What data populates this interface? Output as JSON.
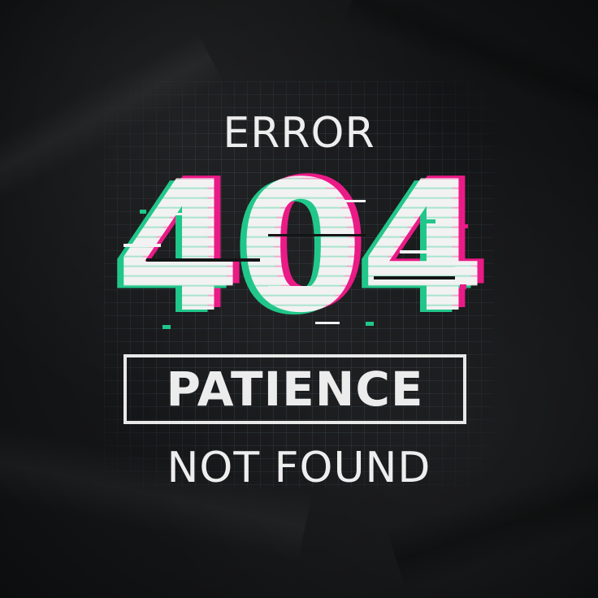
{
  "design": {
    "line1": "ERROR",
    "number": "404",
    "boxed_word": "PATIENCE",
    "line3": "NOT FOUND"
  },
  "colors": {
    "shirt": "#141516",
    "print_white": "#f2f2f2",
    "glitch_magenta": "#ea1a86",
    "glitch_green": "#21c78a",
    "grid_lines": "#50647380"
  }
}
